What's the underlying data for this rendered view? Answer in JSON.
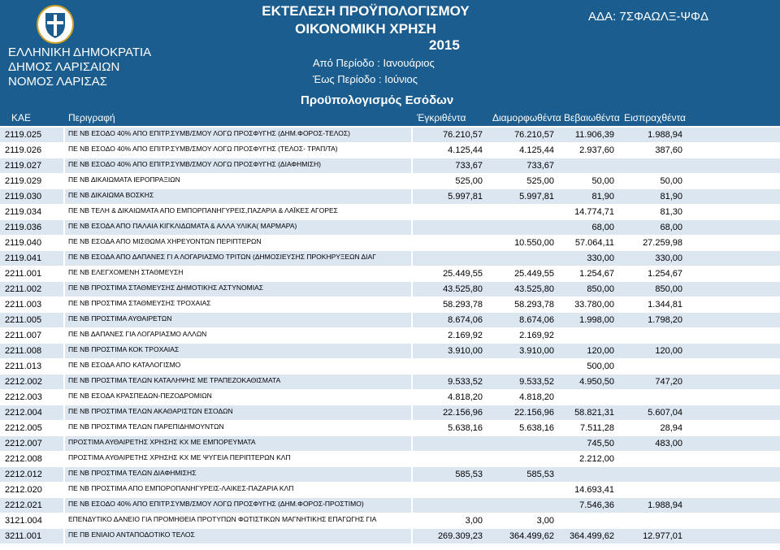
{
  "header": {
    "state": "ΕΛΛΗΝΙΚΗ ΔΗΜΟΚΡΑΤΙΑ",
    "municipality": "ΔΗΜΟΣ ΛΑΡΙΣΑΙΩΝ",
    "prefecture": "ΝΟΜΟΣ ΛΑΡΙΣΑΣ",
    "title_line1": "ΕΚΤΕΛΕΣΗ ΠΡΟΫΠΟΛΟΓΙΣΜΟΥ",
    "title_line2": "ΟΙΚΟΝΟΜΙΚΗ ΧΡΗΣΗ",
    "year": "2015",
    "period_from": "Από Περίοδο : Ιανουάριος",
    "period_to": "Έως Περίοδο : Ιούνιος",
    "ada": "ΑΔΑ: 7ΣΦΑΩΛΞ-ΨΦΔ",
    "section_title": "Προϋπολογισμός Εσόδων"
  },
  "columns": {
    "kae": "ΚΑΕ",
    "desc": "Περιγραφή",
    "approved": "Έγκριθέντα",
    "formed": "Διαμορφωθέντα",
    "certified": "Βεβαιωθέντα",
    "collected": "Εισπραχθέντα"
  },
  "rows": [
    {
      "kae": "2119.025",
      "desc": "ΠΕ ΝΒ ΕΣΟΔΟ 40% ΑΠΟ ΕΠΙΤΡ.ΣΥΜΒ/ΣΜΟΥ ΛΟΓΩ ΠΡΟΣΦΥΓΗΣ (ΔΗΜ.ΦΟΡΟΣ-ΤΕΛΟΣ)",
      "a": "76.210,57",
      "b": "76.210,57",
      "c": "11.906,39",
      "d": "1.988,94"
    },
    {
      "kae": "2119.026",
      "desc": "ΠΕ ΝΒ ΕΣΟΔΟ 40% ΑΠΟ ΕΠΙΤΡ.ΣΥΜΒ/ΣΜΟΥ ΛΟΓΩ ΠΡΟΣΦΥΓΗΣ (ΤΕΛΟΣ- ΤΡΑΠ/ΤΑ)",
      "a": "4.125,44",
      "b": "4.125,44",
      "c": "2.937,60",
      "d": "387,60"
    },
    {
      "kae": "2119.027",
      "desc": "ΠΕ ΝΒ ΕΣΟΔΟ 40% ΑΠΟ ΕΠΙΤΡ.ΣΥΜΒ/ΣΜΟΥ ΛΟΓΩ ΠΡΟΣΦΥΓΗΣ (ΔΙΑΦΗΜΙΣΗ)",
      "a": "733,67",
      "b": "733,67",
      "c": "",
      "d": ""
    },
    {
      "kae": "2119.029",
      "desc": "ΠΕ ΝΒ ΔΙΚΑΙΩΜΑΤΑ ΙΕΡΟΠΡΑΞΙΩΝ",
      "a": "525,00",
      "b": "525,00",
      "c": "50,00",
      "d": "50,00"
    },
    {
      "kae": "2119.030",
      "desc": "ΠΕ ΝΒ ΔΙΚΑΙΩΜΑ ΒΟΣΚΗΣ",
      "a": "5.997,81",
      "b": "5.997,81",
      "c": "81,90",
      "d": "81,90"
    },
    {
      "kae": "2119.034",
      "desc": "ΠΕ ΝΒ ΤΕΛΗ & ΔΙΚΑΙΩΜΑΤΑ ΑΠΟ ΕΜΠΟΡΠΑΝΗΓΥΡΕΙΣ,ΠΑΖΑΡΙΑ & ΛΑΪΚΕΣ ΑΓΟΡΕΣ",
      "a": "",
      "b": "",
      "c": "14.774,71",
      "d": "81,30"
    },
    {
      "kae": "2119.036",
      "desc": "ΠΕ ΝΒ ΕΣΟΔΑ ΑΠΟ ΠΑΛΑΙΑ ΚΙΓΚΛΙΔΩΜΑΤΑ & ΑΛΛΑ ΥΛΙΚΑ( ΜΑΡΜΑΡΑ)",
      "a": "",
      "b": "",
      "c": "68,00",
      "d": "68,00"
    },
    {
      "kae": "2119.040",
      "desc": "ΠΕ ΝΒ ΕΣΟΔΑ ΑΠΟ ΜΙΣΘΩΜΑ ΧΗΡΕΥΟΝΤΩΝ ΠΕΡΙΠΤΕΡΩΝ",
      "a": "",
      "b": "10.550,00",
      "c": "57.064,11",
      "d": "27.259,98"
    },
    {
      "kae": "2119.041",
      "desc": "ΠΕ ΝΒ ΕΣΟΔΑ ΑΠΟ ΔΑΠΑΝΕΣ ΓΙ Α ΛΟΓΑΡΙΑΣΜΟ ΤΡΙΤΩΝ (ΔΗΜΟΣΙΕΥΣΗΣ ΠΡΟΚΗΡΥΞΕΩΝ ΔΙΑΓ",
      "a": "",
      "b": "",
      "c": "330,00",
      "d": "330,00"
    },
    {
      "kae": "2211.001",
      "desc": "ΠΕ ΝΒ ΕΛΕΓΧΟΜΕΝΗ ΣΤΑΘΜΕΥΣΗ",
      "a": "25.449,55",
      "b": "25.449,55",
      "c": "1.254,67",
      "d": "1.254,67"
    },
    {
      "kae": "2211.002",
      "desc": "ΠΕ ΝΒ ΠΡΟΣΤΙΜΑ ΣΤΑΘΜΕΥΣΗΣ ΔΗΜΟΤΙΚΗΣ ΑΣΤΥΝΟΜΙΑΣ",
      "a": "43.525,80",
      "b": "43.525,80",
      "c": "850,00",
      "d": "850,00"
    },
    {
      "kae": "2211.003",
      "desc": "ΠΕ ΝΒ ΠΡΟΣΤΙΜΑ ΣΤΑΘΜΕΥΣΗΣ ΤΡΟΧΑΙΑΣ",
      "a": "58.293,78",
      "b": "58.293,78",
      "c": "33.780,00",
      "d": "1.344,81"
    },
    {
      "kae": "2211.005",
      "desc": "ΠΕ ΝΒ ΠΡΟΣΤΙΜΑ ΑΥΘΑΙΡΕΤΩΝ",
      "a": "8.674,06",
      "b": "8.674,06",
      "c": "1.998,00",
      "d": "1.798,20"
    },
    {
      "kae": "2211.007",
      "desc": "ΠΕ ΝΒ ΔΑΠΑΝΕΣ ΓΙΑ ΛΟΓΑΡΙΑΣΜΟ ΑΛΛΩΝ",
      "a": "2.169,92",
      "b": "2.169,92",
      "c": "",
      "d": ""
    },
    {
      "kae": "2211.008",
      "desc": "ΠΕ ΝΒ ΠΡΟΣΤΙΜΑ ΚΟΚ ΤΡΟΧΑΙΑΣ",
      "a": "3.910,00",
      "b": "3.910,00",
      "c": "120,00",
      "d": "120,00"
    },
    {
      "kae": "2211.013",
      "desc": "ΠΕ ΝΒ ΕΣΟΔΑ ΑΠΟ ΚΑΤΑΛΟΓΙΣΜΟ",
      "a": "",
      "b": "",
      "c": "500,00",
      "d": ""
    },
    {
      "kae": "2212.002",
      "desc": "ΠΕ ΝΒ ΠΡΟΣΤΙΜΑ ΤΕΛΩΝ ΚΑΤΑΛΗΨΗΣ ΜΕ ΤΡΑΠΕΖΟΚΑΘΙΣΜΑΤΑ",
      "a": "9.533,52",
      "b": "9.533,52",
      "c": "4.950,50",
      "d": "747,20"
    },
    {
      "kae": "2212.003",
      "desc": "ΠΕ ΝΒ ΕΣΟΔΑ ΚΡΑΣΠΕΔΩΝ-ΠΕΖΟΔΡΟΜΙΩΝ",
      "a": "4.818,20",
      "b": "4.818,20",
      "c": "",
      "d": ""
    },
    {
      "kae": "2212.004",
      "desc": "ΠΕ ΝΒ ΠΡΟΣΤΙΜΑ ΤΕΛΩΝ ΑΚΑΘΑΡΙΣΤΩΝ ΕΣΟΔΩΝ",
      "a": "22.156,96",
      "b": "22.156,96",
      "c": "58.821,31",
      "d": "5.607,04"
    },
    {
      "kae": "2212.005",
      "desc": "ΠΕ ΝΒ ΠΡΟΣΤΙΜΑ ΤΕΛΩΝ ΠΑΡΕΠΙΔΗΜΟΥΝΤΩΝ",
      "a": "5.638,16",
      "b": "5.638,16",
      "c": "7.511,28",
      "d": "28,94"
    },
    {
      "kae": "2212.007",
      "desc": "ΠΡΟΣΤΙΜΑ ΑΥΘΑΙΡΕΤΗΣ ΧΡΗΣΗΣ ΚΧ ΜΕ ΕΜΠΟΡΕΥΜΑΤΑ",
      "a": "",
      "b": "",
      "c": "745,50",
      "d": "483,00"
    },
    {
      "kae": "2212.008",
      "desc": "ΠΡΟΣΤΙΜΑ ΑΥΘΑΙΡΕΤΗΣ ΧΡΗΣΗΣ ΚΧ ΜΕ ΨΥΓΕΙΑ ΠΕΡΙΠΤΕΡΩΝ ΚΛΠ",
      "a": "",
      "b": "",
      "c": "2.212,00",
      "d": ""
    },
    {
      "kae": "2212.012",
      "desc": "ΠΕ ΝΒ ΠΡΟΣΤΙΜΑ ΤΕΛΩΝ ΔΙΑΦΗΜΙΣΗΣ",
      "a": "585,53",
      "b": "585,53",
      "c": "",
      "d": ""
    },
    {
      "kae": "2212.020",
      "desc": "ΠΕ ΝΒ ΠΡΟΣΤΙΜΑ ΑΠΟ ΕΜΠΟΡΟΠΑΝΗΓΥΡΕΙΣ-ΛΑΙΚΕΣ-ΠΑΖΑΡΙΑ ΚΛΠ",
      "a": "",
      "b": "",
      "c": "14.693,41",
      "d": ""
    },
    {
      "kae": "2212.021",
      "desc": "ΠΕ ΝΒ ΕΣΟΔΟ 40% ΑΠΟ ΕΠΙΤΡ.ΣΥΜΒ/ΣΜΟΥ ΛΟΓΩ ΠΡΟΣΦΥΓΗΣ (ΔΗΜ.ΦΟΡΟΣ-ΠΡΟΣΤΙΜΟ)",
      "a": "",
      "b": "",
      "c": "7.546,36",
      "d": "1.988,94"
    },
    {
      "kae": "3121.004",
      "desc": "ΕΠΕΝΔΥΤΙΚΟ ΔΑΝΕΙΟ ΓΙΑ ΠΡΟΜΗΘΕΙΑ ΠΡΟΤΥΠΩΝ ΦΩΤΙΣΤΙΚΩΝ ΜΑΓΝΗΤΙΚΗΣ ΕΠΑΓΩΓΗΣ ΓΙΑ",
      "a": "3,00",
      "b": "3,00",
      "c": "",
      "d": ""
    },
    {
      "kae": "3211.001",
      "desc": "ΠΕ ΠΒ ΕΝΙΑΙΟ ΑΝΤΑΠΟΔΟΤΙΚΟ ΤΕΛΟΣ",
      "a": "269.309,23",
      "b": "364.499,62",
      "c": "364.499,62",
      "d": "12.977,01"
    }
  ]
}
